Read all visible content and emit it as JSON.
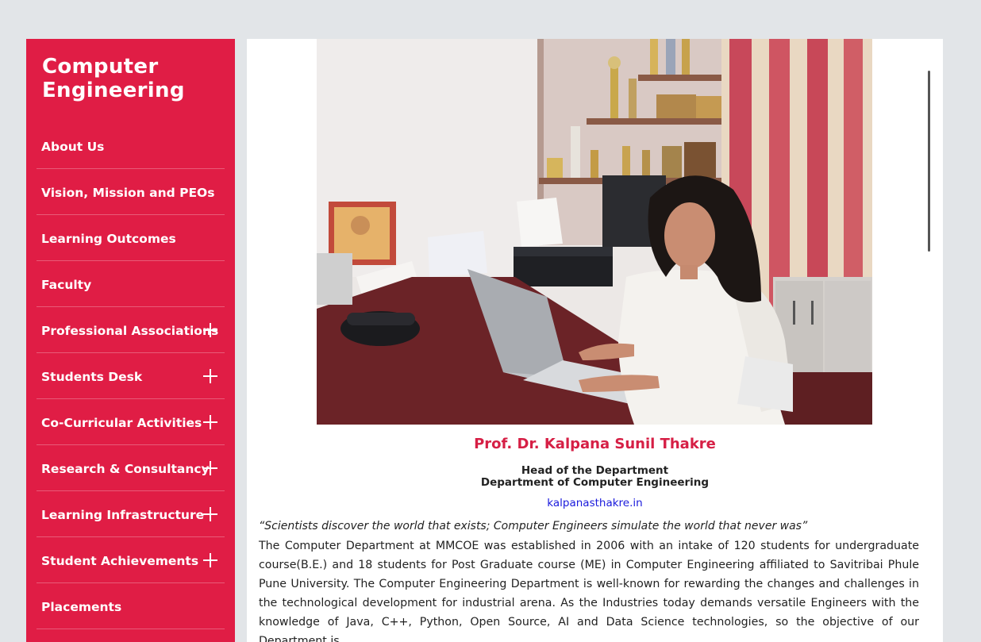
{
  "sidebar": {
    "title": "Computer Engineering",
    "items": [
      {
        "label": "About Us",
        "expandable": false
      },
      {
        "label": "Vision, Mission and PEOs",
        "expandable": false
      },
      {
        "label": "Learning Outcomes",
        "expandable": false
      },
      {
        "label": "Faculty",
        "expandable": false
      },
      {
        "label": "Professional Associations",
        "expandable": true
      },
      {
        "label": "Students Desk",
        "expandable": true
      },
      {
        "label": "Co-Curricular Activities",
        "expandable": true
      },
      {
        "label": "Research & Consultancy",
        "expandable": true
      },
      {
        "label": "Learning Infrastructure",
        "expandable": true
      },
      {
        "label": "Student Achievements",
        "expandable": true
      },
      {
        "label": "Placements",
        "expandable": false
      }
    ]
  },
  "profile": {
    "name": "Prof. Dr. Kalpana Sunil Thakre",
    "role_line1": "Head of the Department",
    "role_line2": "Department of Computer Engineering",
    "link": "kalpanasthakre.in"
  },
  "content": {
    "quote": "“Scientists discover the world that exists; Computer Engineers simulate the world that never was”",
    "paragraph": "The Computer Department at MMCOE was established in 2006 with an intake of 120 students for undergraduate course(B.E.) and 18 students for Post Graduate course (ME) in Computer Engineering affiliated to Savitribai Phule Pune University. The Computer Engineering Department is well-known for rewarding the changes and challenges in the technological development for industrial arena. As the Industries today demands versatile Engineers with the knowledge of Java, C++, Python, Open Source, AI and Data Science technologies, so the objective of our Department is"
  },
  "colors": {
    "sidebar_bg": "#e01d45",
    "name_color": "#d61f45",
    "link_color": "#1a1adc",
    "page_bg": "#e2e5e8"
  }
}
